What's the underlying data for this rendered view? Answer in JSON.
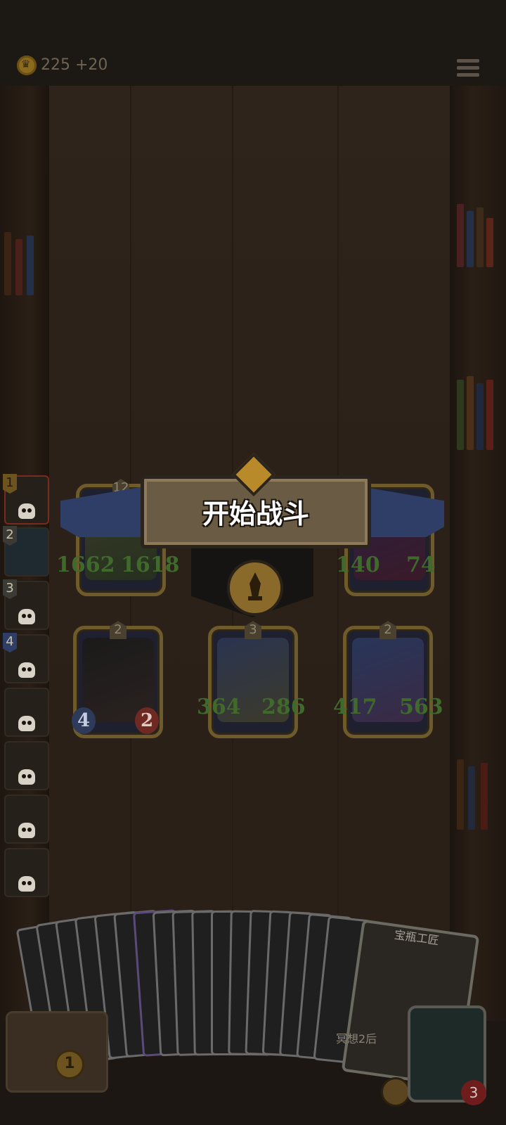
{
  "header": {
    "coins": "225",
    "coin_income": "+20"
  },
  "battle_banner": {
    "label": "开始战斗"
  },
  "sidebar": {
    "slots": [
      {
        "num": "1",
        "name": "sidebar-slot-1"
      },
      {
        "num": "2",
        "name": "sidebar-slot-2"
      },
      {
        "num": "3",
        "name": "sidebar-slot-3"
      },
      {
        "num": "4",
        "name": "sidebar-slot-4"
      },
      {
        "num": "",
        "name": "sidebar-slot-5"
      },
      {
        "num": "",
        "name": "sidebar-slot-6"
      },
      {
        "num": "",
        "name": "sidebar-slot-7"
      },
      {
        "num": "",
        "name": "sidebar-slot-8"
      }
    ]
  },
  "board": {
    "top_row": [
      {
        "stars": "12",
        "attack": "1662",
        "health": "1618"
      },
      {
        "stars": "",
        "attack": "140",
        "health": "74"
      }
    ],
    "bottom_row": [
      {
        "stars": "2",
        "attack": "4",
        "health": "2"
      },
      {
        "stars": "3",
        "attack": "364",
        "health": "286"
      },
      {
        "stars": "2",
        "attack": "417",
        "health": "563"
      }
    ]
  },
  "hand": {
    "featured_card_name": "宝瓶工匠",
    "featured_card_desc": "冥想2后"
  },
  "player": {
    "chest_level": "1",
    "hero_health": "3"
  },
  "colors": {
    "stat_text": "#3f6a2c",
    "banner_ribbon": "#2e3e66",
    "card_frame": "#6e5a2a"
  },
  "icons": [
    "crown-coin-icon",
    "menu-icon",
    "skull-icon",
    "sword-emblem-icon",
    "chest-icon",
    "heart-icon",
    "shield-icon"
  ]
}
